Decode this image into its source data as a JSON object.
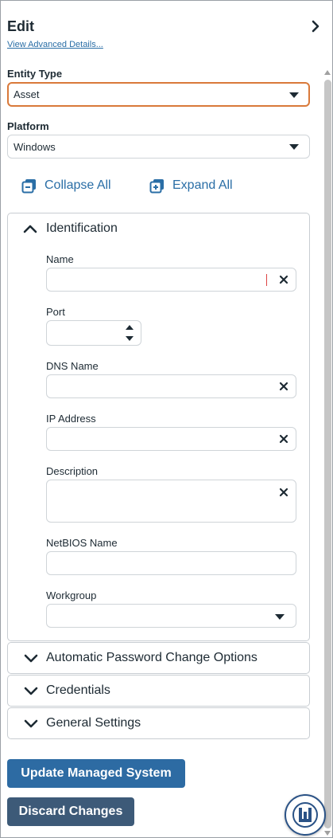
{
  "header": {
    "title": "Edit",
    "advanced_link": "View Advanced Details..."
  },
  "entity_type": {
    "label": "Entity Type",
    "value": "Asset"
  },
  "platform": {
    "label": "Platform",
    "value": "Windows"
  },
  "actions": {
    "collapse_all": "Collapse All",
    "expand_all": "Expand All"
  },
  "identification": {
    "title": "Identification",
    "fields": {
      "name": {
        "label": "Name",
        "value": ""
      },
      "port": {
        "label": "Port",
        "value": ""
      },
      "dns_name": {
        "label": "DNS Name",
        "value": ""
      },
      "ip_address": {
        "label": "IP Address",
        "value": ""
      },
      "description": {
        "label": "Description",
        "value": ""
      },
      "netbios_name": {
        "label": "NetBIOS Name",
        "value": ""
      },
      "workgroup": {
        "label": "Workgroup",
        "value": ""
      }
    }
  },
  "sections": [
    {
      "title": "Automatic Password Change Options"
    },
    {
      "title": "Credentials"
    },
    {
      "title": "General Settings"
    }
  ],
  "buttons": {
    "update": "Update Managed System",
    "discard": "Discard Changes"
  },
  "colors": {
    "accent": "#2a6ea6",
    "primary_button": "#2d6ba3",
    "secondary_button": "#3d5a78",
    "focus_border": "#d9793a"
  },
  "icons": [
    "chevron-right-icon",
    "collapse-all-icon",
    "expand-all-icon",
    "chevron-up-icon",
    "chevron-down-icon",
    "clear-icon",
    "caret-down-icon",
    "spinner-up-icon",
    "spinner-down-icon",
    "beyondtrust-logo-icon"
  ]
}
